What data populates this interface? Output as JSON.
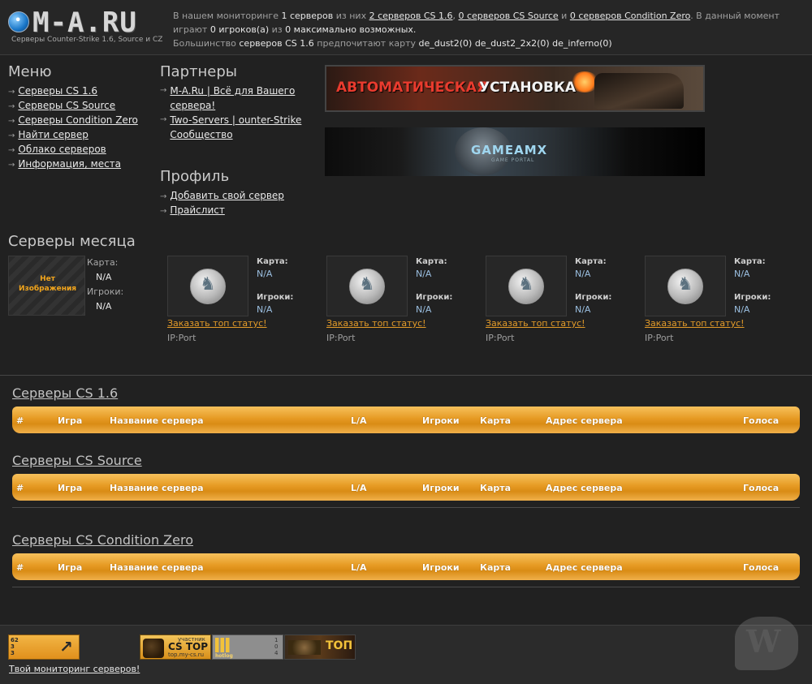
{
  "header": {
    "logo_text": "M-A.RU",
    "logo_sub": "Серверы Counter-Strike 1.6, Source и CZ",
    "stats": {
      "t1": "В нашем мониторинге",
      "servers_total": "1 серверов",
      "t2": "из них",
      "cs16": "2 серверов CS 1.6",
      "comma1": ",",
      "source": "0 серверов CS Source",
      "and": "и",
      "cz": "0 серверов Condition Zero",
      "t3": ". В данный момент играют",
      "players": "0 игроков(а)",
      "t4": "из",
      "max": "0 максимально возможных.",
      "t5": "Большинство",
      "cs16_servers": "серверов CS 1.6",
      "t6": "предпочитают карту",
      "maps": "de_dust2(0)  de_dust2_2x2(0)  de_inferno(0)"
    }
  },
  "menu": {
    "title": "Меню",
    "items": [
      {
        "label": "Серверы CS 1.6"
      },
      {
        "label": "Серверы CS Source"
      },
      {
        "label": "Серверы Condition Zero"
      },
      {
        "label": "Найти сервер"
      },
      {
        "label": "Облако серверов"
      },
      {
        "label": "Информация, места"
      }
    ]
  },
  "partners": {
    "title": "Партнеры",
    "items": [
      {
        "label": "M-A.Ru | Всё для Вашего сервера!"
      },
      {
        "label": "Two-Servers | ounter-Strike Сообщество"
      }
    ]
  },
  "profile": {
    "title": "Профиль",
    "items": [
      {
        "label": "Добавить свой сервер"
      },
      {
        "label": "Прайслист"
      }
    ]
  },
  "banners": {
    "b1_red": "АВТОМАТИЧЕСКАЯ",
    "b1_white": "УСТАНОВКА",
    "b2_title": "GAMEAMX",
    "b2_sub": "GAME PORTAL"
  },
  "month": {
    "title": "Серверы месяца",
    "first": {
      "noimg": "Нет Изображения",
      "map_label": "Карта:",
      "map_value": "N/A",
      "players_label": "Игроки:",
      "players_value": "N/A"
    },
    "cards": [
      {
        "map_label": "Карта:",
        "map": "N/A",
        "players_label": "Игроки:",
        "players": "N/A",
        "order": "Заказать топ статус!",
        "ip": "IP:Port"
      },
      {
        "map_label": "Карта:",
        "map": "N/A",
        "players_label": "Игроки:",
        "players": "N/A",
        "order": "Заказать топ статус!",
        "ip": "IP:Port"
      },
      {
        "map_label": "Карта:",
        "map": "N/A",
        "players_label": "Игроки:",
        "players": "N/A",
        "order": "Заказать топ статус!",
        "ip": "IP:Port"
      },
      {
        "map_label": "Карта:",
        "map": "N/A",
        "players_label": "Игроки:",
        "players": "N/A",
        "order": "Заказать топ статус!",
        "ip": "IP:Port"
      }
    ]
  },
  "columns": [
    "#",
    "Игра",
    "Название сервера",
    "L/A",
    "Игроки",
    "Карта",
    "Адрес сервера",
    "Голоса"
  ],
  "sections": [
    {
      "title": "Серверы CS 1.6"
    },
    {
      "title": "Серверы CS Source"
    },
    {
      "title": "Серверы CS Condition Zero"
    }
  ],
  "footer": {
    "btn88_nums": "62\n3\n3",
    "link": "Твой мониторинг серверов!",
    "cstop_a": "участник",
    "cstop_b": "CS TOP",
    "cstop_c": "top.my-cs.ru",
    "hotlog": "hotlog",
    "hotlog_side": "1 0 4",
    "top": "ТОП"
  },
  "watermark": "W",
  "colors": {
    "background": "#212121",
    "accent_orange": "#e39b29",
    "link_blue": "#9bbfe1"
  }
}
